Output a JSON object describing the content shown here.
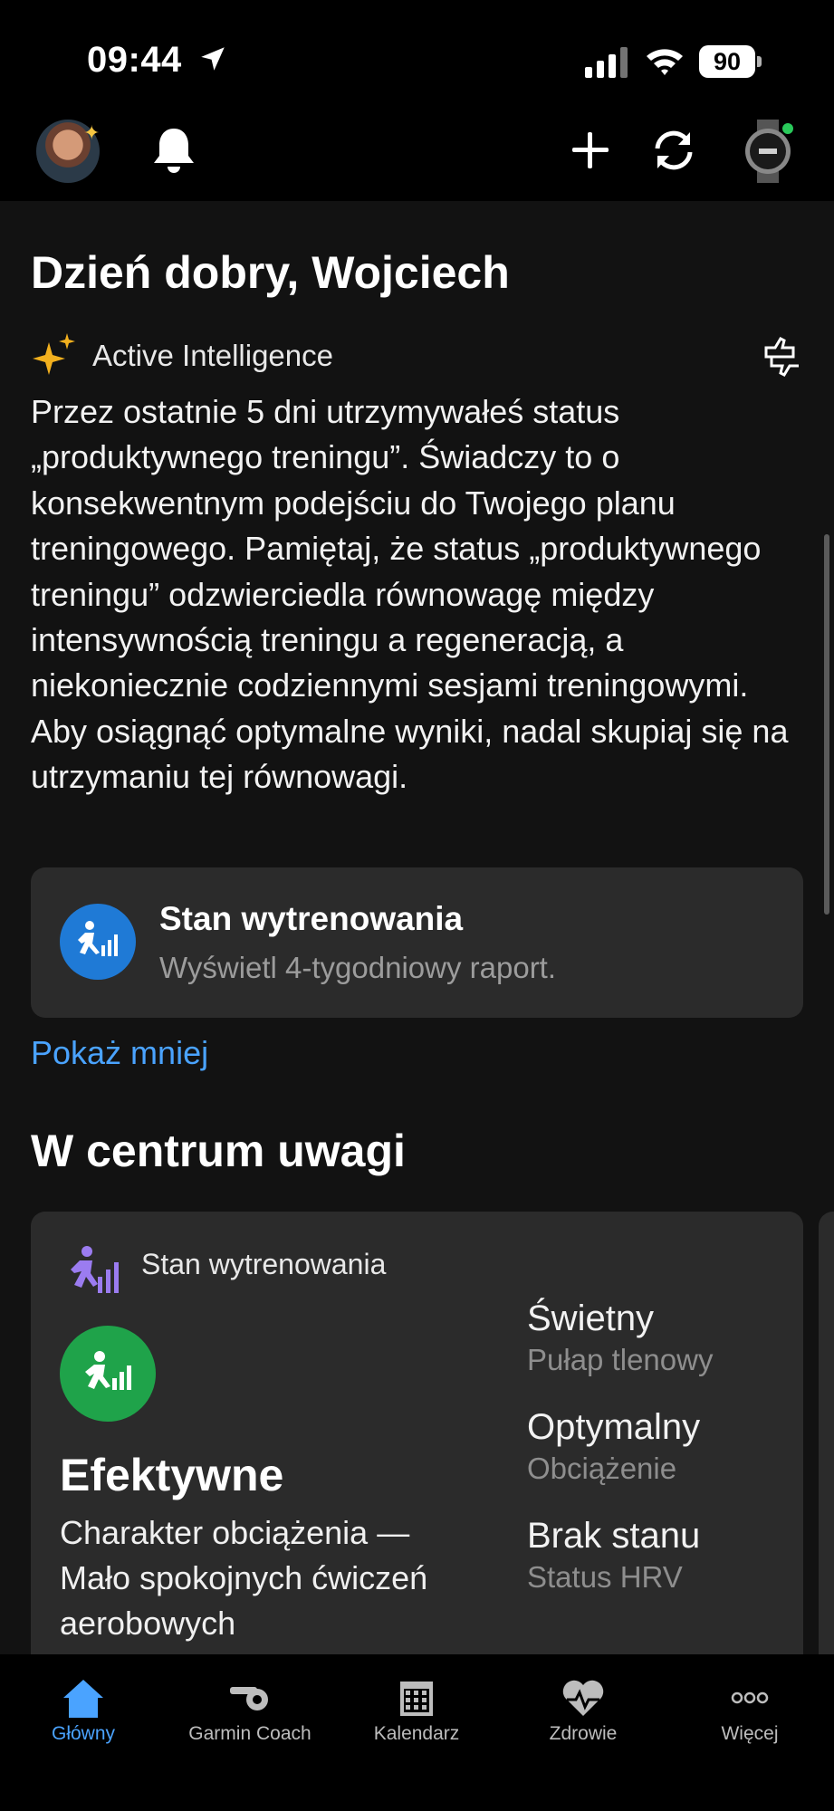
{
  "status_bar": {
    "time": "09:44",
    "battery": "90"
  },
  "header": {
    "avatar_icon": "user-avatar",
    "bell_icon": "bell-icon",
    "plus_icon": "plus-icon",
    "sync_icon": "sync-icon",
    "watch_icon": "watch-device-icon",
    "watch_status_color": "#29c95a"
  },
  "main": {
    "greeting": "Dzień dobry, Wojciech",
    "active_intelligence": {
      "label": "Active Intelligence",
      "text": "Przez ostatnie 5 dni utrzymywałeś status „produktywnego treningu”. Świadczy to o konsekwentnym podejściu do Twojego planu treningowego. Pamiętaj, że status „produktywnego treningu” odzwierciedla równowagę między intensywnością treningu a regeneracją, a niekoniecznie codziennymi sesjami treningowymi. Aby osiągnąć optymalne wyniki, nadal skupiaj się na utrzymaniu tej równowagi."
    },
    "report_card": {
      "title": "Stan wytrenowania",
      "subtitle": "Wyświetl 4-tygodniowy raport.",
      "icon_color": "#1f7ad6"
    },
    "show_less": "Pokaż mniej",
    "spotlight_title": "W centrum uwagi",
    "focus_card": {
      "label": "Stan wytrenowania",
      "status": "Efektywne",
      "description": "Charakter obciążenia — Mało spokojnych ćwiczeń aerobowych",
      "badge_color": "#1fa34a",
      "metrics": [
        {
          "value": "Świetny",
          "label": "Pułap tlenowy"
        },
        {
          "value": "Optymalny",
          "label": "Obciążenie"
        },
        {
          "value": "Brak stanu",
          "label": "Status HRV"
        }
      ]
    }
  },
  "tabbar": {
    "accent": "#4aa3ff",
    "tabs": [
      {
        "label": "Główny",
        "icon": "home-icon"
      },
      {
        "label": "Garmin Coach",
        "icon": "whistle-icon"
      },
      {
        "label": "Kalendarz",
        "icon": "calendar-icon"
      },
      {
        "label": "Zdrowie",
        "icon": "heart-icon"
      },
      {
        "label": "Więcej",
        "icon": "more-icon"
      }
    ]
  }
}
